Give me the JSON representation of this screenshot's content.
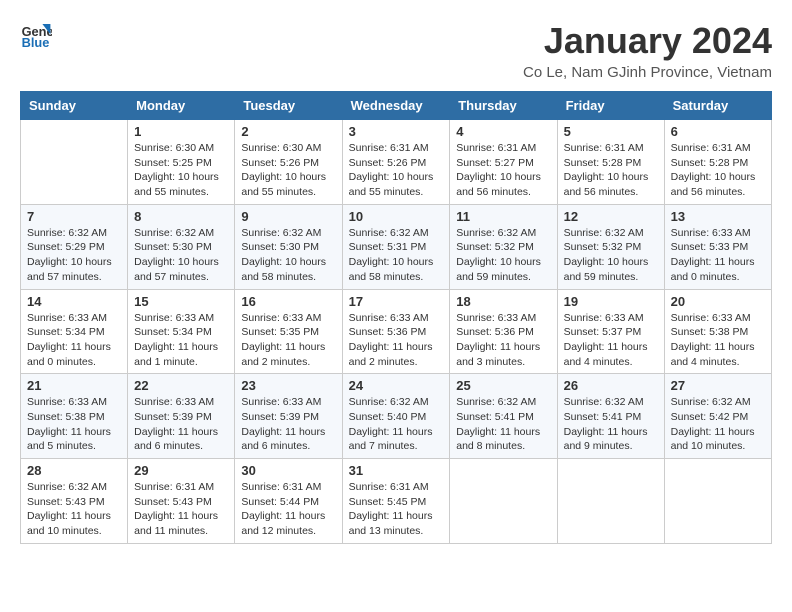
{
  "logo": {
    "line1": "General",
    "line2": "Blue"
  },
  "title": "January 2024",
  "subtitle": "Co Le, Nam GJinh Province, Vietnam",
  "days_header": [
    "Sunday",
    "Monday",
    "Tuesday",
    "Wednesday",
    "Thursday",
    "Friday",
    "Saturday"
  ],
  "weeks": [
    [
      {
        "day": "",
        "info": ""
      },
      {
        "day": "1",
        "info": "Sunrise: 6:30 AM\nSunset: 5:25 PM\nDaylight: 10 hours\nand 55 minutes."
      },
      {
        "day": "2",
        "info": "Sunrise: 6:30 AM\nSunset: 5:26 PM\nDaylight: 10 hours\nand 55 minutes."
      },
      {
        "day": "3",
        "info": "Sunrise: 6:31 AM\nSunset: 5:26 PM\nDaylight: 10 hours\nand 55 minutes."
      },
      {
        "day": "4",
        "info": "Sunrise: 6:31 AM\nSunset: 5:27 PM\nDaylight: 10 hours\nand 56 minutes."
      },
      {
        "day": "5",
        "info": "Sunrise: 6:31 AM\nSunset: 5:28 PM\nDaylight: 10 hours\nand 56 minutes."
      },
      {
        "day": "6",
        "info": "Sunrise: 6:31 AM\nSunset: 5:28 PM\nDaylight: 10 hours\nand 56 minutes."
      }
    ],
    [
      {
        "day": "7",
        "info": "Sunrise: 6:32 AM\nSunset: 5:29 PM\nDaylight: 10 hours\nand 57 minutes."
      },
      {
        "day": "8",
        "info": "Sunrise: 6:32 AM\nSunset: 5:30 PM\nDaylight: 10 hours\nand 57 minutes."
      },
      {
        "day": "9",
        "info": "Sunrise: 6:32 AM\nSunset: 5:30 PM\nDaylight: 10 hours\nand 58 minutes."
      },
      {
        "day": "10",
        "info": "Sunrise: 6:32 AM\nSunset: 5:31 PM\nDaylight: 10 hours\nand 58 minutes."
      },
      {
        "day": "11",
        "info": "Sunrise: 6:32 AM\nSunset: 5:32 PM\nDaylight: 10 hours\nand 59 minutes."
      },
      {
        "day": "12",
        "info": "Sunrise: 6:32 AM\nSunset: 5:32 PM\nDaylight: 10 hours\nand 59 minutes."
      },
      {
        "day": "13",
        "info": "Sunrise: 6:33 AM\nSunset: 5:33 PM\nDaylight: 11 hours\nand 0 minutes."
      }
    ],
    [
      {
        "day": "14",
        "info": "Sunrise: 6:33 AM\nSunset: 5:34 PM\nDaylight: 11 hours\nand 0 minutes."
      },
      {
        "day": "15",
        "info": "Sunrise: 6:33 AM\nSunset: 5:34 PM\nDaylight: 11 hours\nand 1 minute."
      },
      {
        "day": "16",
        "info": "Sunrise: 6:33 AM\nSunset: 5:35 PM\nDaylight: 11 hours\nand 2 minutes."
      },
      {
        "day": "17",
        "info": "Sunrise: 6:33 AM\nSunset: 5:36 PM\nDaylight: 11 hours\nand 2 minutes."
      },
      {
        "day": "18",
        "info": "Sunrise: 6:33 AM\nSunset: 5:36 PM\nDaylight: 11 hours\nand 3 minutes."
      },
      {
        "day": "19",
        "info": "Sunrise: 6:33 AM\nSunset: 5:37 PM\nDaylight: 11 hours\nand 4 minutes."
      },
      {
        "day": "20",
        "info": "Sunrise: 6:33 AM\nSunset: 5:38 PM\nDaylight: 11 hours\nand 4 minutes."
      }
    ],
    [
      {
        "day": "21",
        "info": "Sunrise: 6:33 AM\nSunset: 5:38 PM\nDaylight: 11 hours\nand 5 minutes."
      },
      {
        "day": "22",
        "info": "Sunrise: 6:33 AM\nSunset: 5:39 PM\nDaylight: 11 hours\nand 6 minutes."
      },
      {
        "day": "23",
        "info": "Sunrise: 6:33 AM\nSunset: 5:39 PM\nDaylight: 11 hours\nand 6 minutes."
      },
      {
        "day": "24",
        "info": "Sunrise: 6:32 AM\nSunset: 5:40 PM\nDaylight: 11 hours\nand 7 minutes."
      },
      {
        "day": "25",
        "info": "Sunrise: 6:32 AM\nSunset: 5:41 PM\nDaylight: 11 hours\nand 8 minutes."
      },
      {
        "day": "26",
        "info": "Sunrise: 6:32 AM\nSunset: 5:41 PM\nDaylight: 11 hours\nand 9 minutes."
      },
      {
        "day": "27",
        "info": "Sunrise: 6:32 AM\nSunset: 5:42 PM\nDaylight: 11 hours\nand 10 minutes."
      }
    ],
    [
      {
        "day": "28",
        "info": "Sunrise: 6:32 AM\nSunset: 5:43 PM\nDaylight: 11 hours\nand 10 minutes."
      },
      {
        "day": "29",
        "info": "Sunrise: 6:31 AM\nSunset: 5:43 PM\nDaylight: 11 hours\nand 11 minutes."
      },
      {
        "day": "30",
        "info": "Sunrise: 6:31 AM\nSunset: 5:44 PM\nDaylight: 11 hours\nand 12 minutes."
      },
      {
        "day": "31",
        "info": "Sunrise: 6:31 AM\nSunset: 5:45 PM\nDaylight: 11 hours\nand 13 minutes."
      },
      {
        "day": "",
        "info": ""
      },
      {
        "day": "",
        "info": ""
      },
      {
        "day": "",
        "info": ""
      }
    ]
  ]
}
